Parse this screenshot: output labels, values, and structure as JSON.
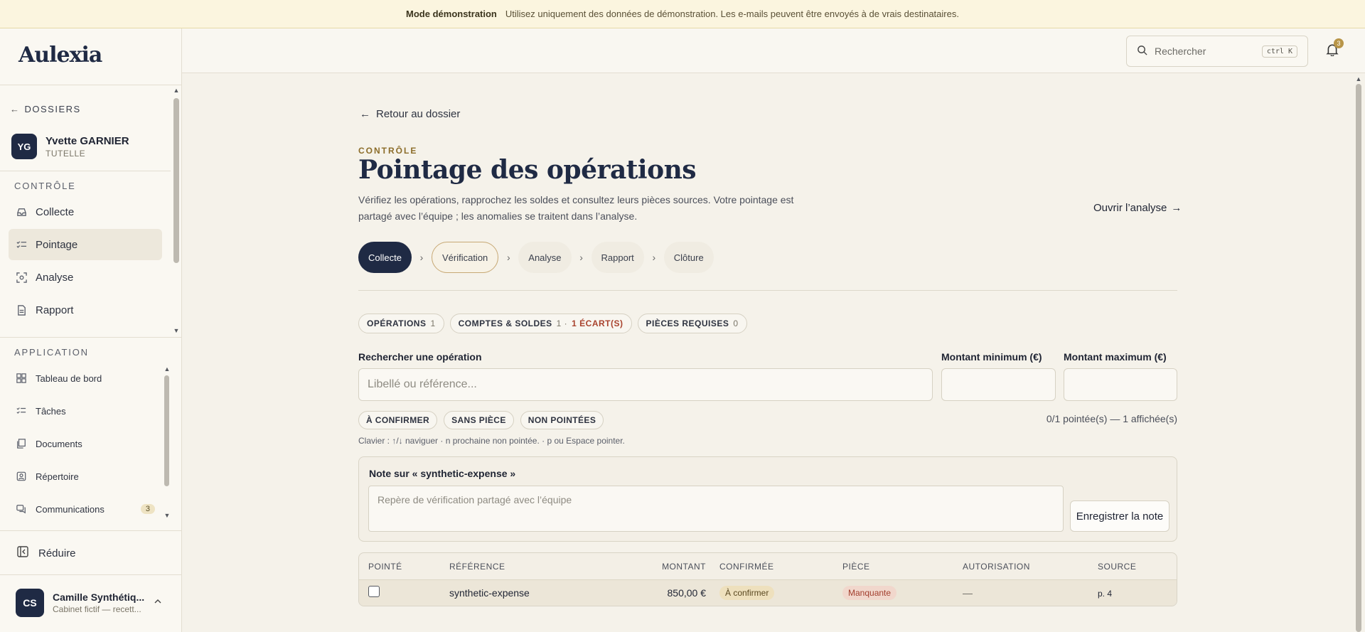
{
  "banner": {
    "title": "Mode démonstration",
    "text": "Utilisez uniquement des données de démonstration. Les e-mails peuvent être envoyés à de vrais destinataires."
  },
  "sidebar": {
    "logo": "Aulexia",
    "back_label": "DOSSIERS",
    "client": {
      "initials": "YG",
      "name": "Yvette GARNIER",
      "sub": "TUTELLE"
    },
    "section_controle": "CONTRÔLE",
    "controle_items": [
      {
        "label": "Collecte",
        "icon": "inbox-icon"
      },
      {
        "label": "Pointage",
        "icon": "checklist-icon"
      },
      {
        "label": "Analyse",
        "icon": "scan-icon"
      },
      {
        "label": "Rapport",
        "icon": "document-icon"
      }
    ],
    "section_app": "APPLICATION",
    "app_items": [
      {
        "label": "Tableau de bord",
        "icon": "dashboard-icon"
      },
      {
        "label": "Tâches",
        "icon": "tasks-icon"
      },
      {
        "label": "Documents",
        "icon": "files-icon"
      },
      {
        "label": "Répertoire",
        "icon": "contacts-icon"
      },
      {
        "label": "Communications",
        "icon": "chat-icon",
        "badge": "3"
      }
    ],
    "reduce_label": "Réduire",
    "user": {
      "initials": "CS",
      "name": "Camille Synthétiq...",
      "sub": "Cabinet fictif — recett..."
    }
  },
  "topbar": {
    "search_placeholder": "Rechercher",
    "search_shortcut": "ctrl K",
    "notif_count": "3"
  },
  "main": {
    "back_label": "Retour au dossier",
    "kicker": "CONTRÔLE",
    "title": "Pointage des opérations",
    "description": "Vérifiez les opérations, rapprochez les soldes et consultez leurs pièces sources. Votre pointage est partagé avec l’équipe ; les anomalies se traitent dans l’analyse.",
    "open_analysis": "Ouvrir l’analyse",
    "steps": [
      "Collecte",
      "Vérification",
      "Analyse",
      "Rapport",
      "Clôture"
    ],
    "tabs": [
      {
        "label": "OPÉRATIONS",
        "count": "1"
      },
      {
        "label": "COMPTES & SOLDES",
        "count": "1 ·",
        "warning": "1 ÉCART(S)"
      },
      {
        "label": "PIÈCES REQUISES",
        "count": "0"
      }
    ],
    "search_label": "Rechercher une opération",
    "search_placeholder": "Libellé ou référence...",
    "min_label": "Montant minimum (€)",
    "max_label": "Montant maximum (€)",
    "filters": [
      "À CONFIRMER",
      "SANS PIÈCE",
      "NON POINTÉES"
    ],
    "count_text": "0/1 pointée(s) — 1 affichée(s)",
    "hint": "Clavier : ↑/↓ naviguer · n prochaine non pointée. · p ou Espace pointer.",
    "note": {
      "title": "Note sur « synthetic-expense »",
      "placeholder": "Repère de vérification partagé avec l’équipe",
      "save_label": "Enregistrer la note"
    },
    "table": {
      "headers": [
        "POINTÉ",
        "RÉFÉRENCE",
        "MONTANT",
        "CONFIRMÉE",
        "PIÈCE",
        "AUTORISATION",
        "SOURCE"
      ],
      "rows": [
        {
          "reference": "synthetic-expense",
          "amount": "850,00 €",
          "confirmed": "À confirmer",
          "piece": "Manquante",
          "authorisation": "—",
          "source": "p. 4"
        }
      ]
    }
  }
}
